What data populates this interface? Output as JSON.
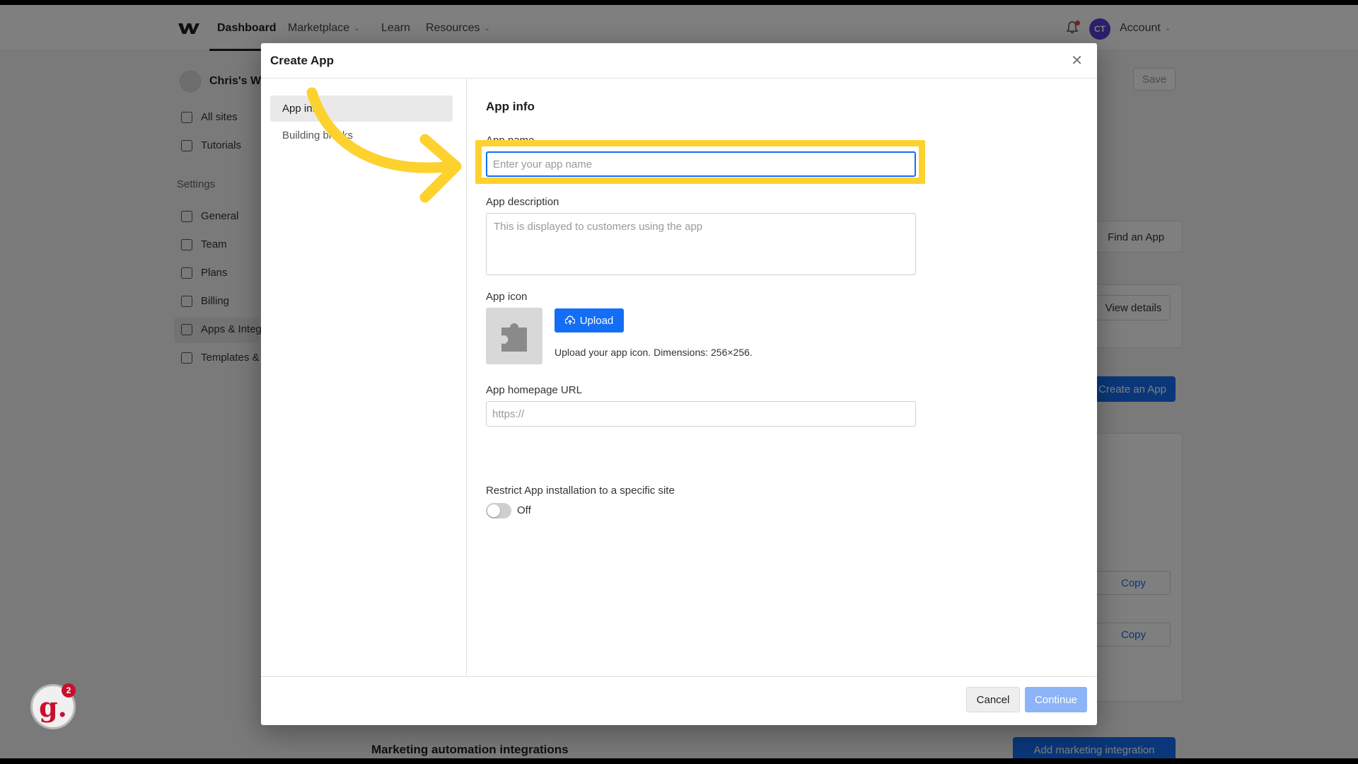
{
  "nav": {
    "items": [
      {
        "label": "Dashboard"
      },
      {
        "label": "Marketplace"
      },
      {
        "label": "Learn"
      },
      {
        "label": "Resources"
      }
    ],
    "avatar_initials": "CT",
    "account_label": "Account"
  },
  "sidebar": {
    "workspace_name": "Chris's Wo",
    "items": [
      {
        "label": "All sites"
      },
      {
        "label": "Tutorials"
      }
    ],
    "settings_heading": "Settings",
    "settings_items": [
      {
        "label": "General"
      },
      {
        "label": "Team"
      },
      {
        "label": "Plans"
      },
      {
        "label": "Billing"
      },
      {
        "label": "Apps & Integ"
      },
      {
        "label": "Templates &"
      }
    ]
  },
  "background": {
    "save_label": "Save",
    "find_app_label": "Find an App",
    "view_details_label": "View details",
    "create_app_label": "Create an App",
    "copy_label": "Copy",
    "marketing_title": "Marketing automation integrations",
    "add_marketing_label": "Add marketing integration"
  },
  "modal": {
    "title": "Create App",
    "close_icon": "close-icon",
    "steps": [
      {
        "label": "App info"
      },
      {
        "label": "Building blocks"
      }
    ],
    "section_title": "App info",
    "app_name": {
      "label": "App name",
      "placeholder": "Enter your app name",
      "value": ""
    },
    "app_description": {
      "label": "App description",
      "placeholder": "This is displayed to customers using the app",
      "value": ""
    },
    "app_icon": {
      "label": "App icon",
      "upload_label": "Upload",
      "hint": "Upload your app icon. Dimensions: 256×256."
    },
    "homepage": {
      "label": "App homepage URL",
      "placeholder": "https://",
      "value": ""
    },
    "restrict": {
      "label": "Restrict App installation to a specific site",
      "state_label": "Off"
    },
    "cancel_label": "Cancel",
    "continue_label": "Continue"
  },
  "guide_badge": {
    "letter": "g.",
    "count": "2"
  },
  "colors": {
    "accent": "#146ef5",
    "highlight": "#fdd22f",
    "badge": "#c8102e"
  }
}
